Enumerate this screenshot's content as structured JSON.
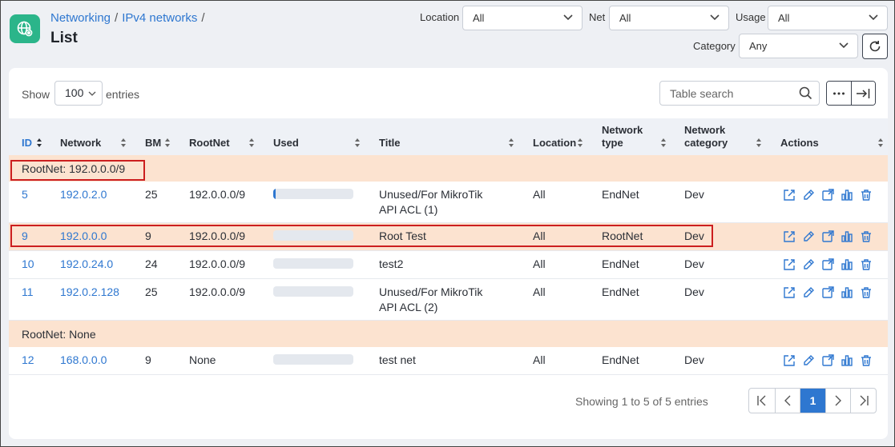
{
  "breadcrumb": {
    "items": [
      "Networking",
      "IPv4 networks"
    ],
    "separator": "/"
  },
  "page_title": "List",
  "filters": {
    "location": {
      "label": "Location",
      "value": "All"
    },
    "net": {
      "label": "Net",
      "value": "All"
    },
    "usage": {
      "label": "Usage",
      "value": "All"
    },
    "category": {
      "label": "Category",
      "value": "Any"
    }
  },
  "toolbar": {
    "show_label": "Show",
    "entries_label": "entries",
    "page_length": "100",
    "search_placeholder": "Table search"
  },
  "columns": [
    "ID",
    "Network",
    "BM",
    "RootNet",
    "Used",
    "Title",
    "Location",
    "Network type",
    "Network category",
    "Actions"
  ],
  "groups": [
    {
      "label": "RootNet: 192.0.0.0/9",
      "rows": [
        {
          "id": "5",
          "network": "192.0.2.0",
          "bm": "25",
          "rootnet": "192.0.0.0/9",
          "used_percent": 3,
          "title": "Unused/For MikroTik API ACL (1)",
          "location": "All",
          "type": "EndNet",
          "category": "Dev"
        },
        {
          "id": "9",
          "network": "192.0.0.0",
          "bm": "9",
          "rootnet": "192.0.0.0/9",
          "used_percent": 0,
          "title": "Root Test",
          "location": "All",
          "type": "RootNet",
          "category": "Dev"
        },
        {
          "id": "10",
          "network": "192.0.24.0",
          "bm": "24",
          "rootnet": "192.0.0.0/9",
          "used_percent": 0,
          "title": "test2",
          "location": "All",
          "type": "EndNet",
          "category": "Dev"
        },
        {
          "id": "11",
          "network": "192.0.2.128",
          "bm": "25",
          "rootnet": "192.0.0.0/9",
          "used_percent": 0,
          "title": "Unused/For MikroTik API ACL (2)",
          "location": "All",
          "type": "EndNet",
          "category": "Dev"
        }
      ]
    },
    {
      "label": "RootNet: None",
      "rows": [
        {
          "id": "12",
          "network": "168.0.0.0",
          "bm": "9",
          "rootnet": "None",
          "used_percent": 0,
          "title": "test net",
          "location": "All",
          "type": "EndNet",
          "category": "Dev"
        }
      ]
    }
  ],
  "footer": {
    "info": "Showing 1 to 5 of 5 entries",
    "current_page": "1"
  },
  "colors": {
    "accent": "#2e77d0",
    "brand_icon": "#2bb58a",
    "group_row": "#fce3d0",
    "highlight_box": "#cc1f1f"
  },
  "icons": [
    "network-globe-icon",
    "chevron-down-icon",
    "refresh-icon",
    "search-icon",
    "more-horizontal-icon",
    "export-icon",
    "sort-icon",
    "open-icon",
    "edit-icon",
    "open-window-icon",
    "chart-icon",
    "delete-icon",
    "first-page-icon",
    "prev-page-icon",
    "next-page-icon",
    "last-page-icon"
  ]
}
